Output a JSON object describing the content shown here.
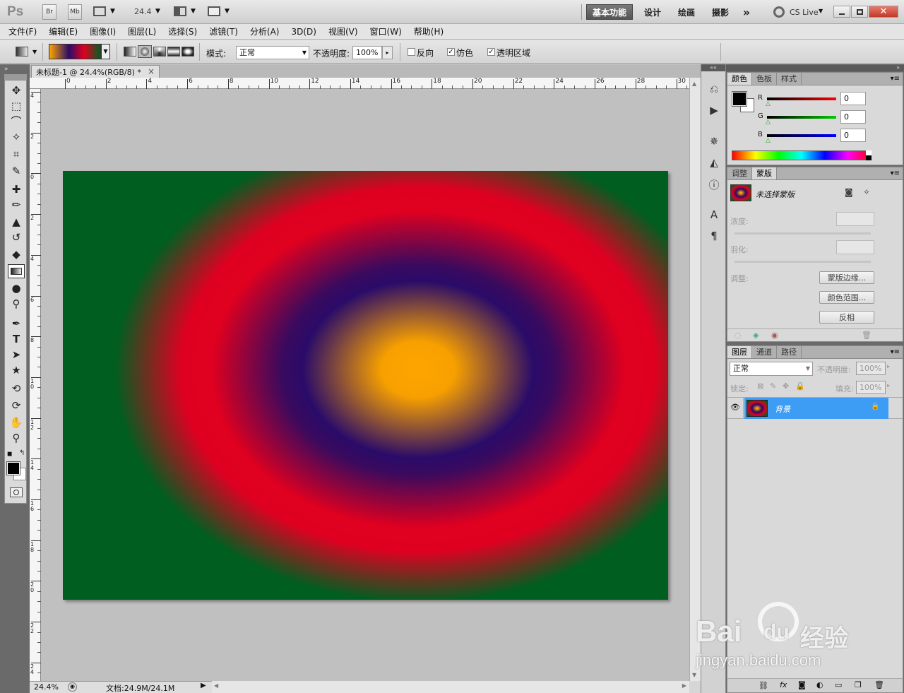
{
  "app": {
    "logo": "Ps",
    "bridge": "Br",
    "minibridge": "Mb",
    "zoom_value": "24.4"
  },
  "workspaces": [
    "基本功能",
    "设计",
    "绘画",
    "摄影"
  ],
  "more_workspaces": "»",
  "cslive": "CS Live",
  "menus": [
    "文件(F)",
    "编辑(E)",
    "图像(I)",
    "图层(L)",
    "选择(S)",
    "滤镜(T)",
    "分析(A)",
    "3D(D)",
    "视图(V)",
    "窗口(W)",
    "帮助(H)"
  ],
  "options": {
    "mode_label": "模式:",
    "mode_value": "正常",
    "opacity_label": "不透明度:",
    "opacity_value": "100%",
    "reverse_label": "反向",
    "dither_label": "仿色",
    "transparency_label": "透明区域",
    "reverse_checked": false,
    "dither_checked": true,
    "transparency_checked": true
  },
  "document": {
    "tab_title": "未标题-1 @ 24.4%(RGB/8) *",
    "close": "×"
  },
  "rulers": {
    "top_ticks": [
      "0",
      "2",
      "4",
      "6",
      "8",
      "10",
      "12",
      "14",
      "16",
      "18",
      "20",
      "22",
      "24",
      "26",
      "28",
      "30"
    ],
    "left_ticks": [
      "4",
      "2",
      "0",
      "2",
      "4",
      "6",
      "8",
      "1 0",
      "1 2",
      "1 4",
      "1 6",
      "1 8",
      "2 0",
      "2 2",
      "2 4"
    ]
  },
  "status": {
    "zoom": "24.4%",
    "doc_info": "文档:24.9M/24.1M"
  },
  "color_panel": {
    "tabs": [
      "颜色",
      "色板",
      "样式"
    ],
    "r_label": "R",
    "g_label": "G",
    "b_label": "B",
    "r_value": "0",
    "g_value": "0",
    "b_value": "0"
  },
  "masks_panel": {
    "tabs": [
      "调整",
      "蒙版"
    ],
    "status": "未选择蒙版",
    "density_label": "浓度:",
    "feather_label": "羽化:",
    "refine_label": "调整:",
    "mask_edge_button": "蒙版边缘...",
    "color_range_button": "颜色范围...",
    "invert_button": "反相"
  },
  "layers_panel": {
    "tabs": [
      "图层",
      "通道",
      "路径"
    ],
    "blend_mode": "正常",
    "opacity_label": "不透明度:",
    "opacity_value": "100%",
    "lock_label": "锁定:",
    "fill_label": "填充:",
    "fill_value": "100%",
    "layers": [
      {
        "name": "背景",
        "visible": true,
        "locked": true,
        "selected": true
      }
    ]
  },
  "watermark": {
    "brand": "Bai",
    "brand2": "du",
    "cn": "经验",
    "url": "jingyan.baidu.com"
  },
  "colors": {
    "fg": "#000000",
    "bg": "#ffffff",
    "selection": "#3d9cf3",
    "gradient_stops": [
      "#ffa500",
      "#2a0b69",
      "#e0001f",
      "#005e20"
    ]
  }
}
